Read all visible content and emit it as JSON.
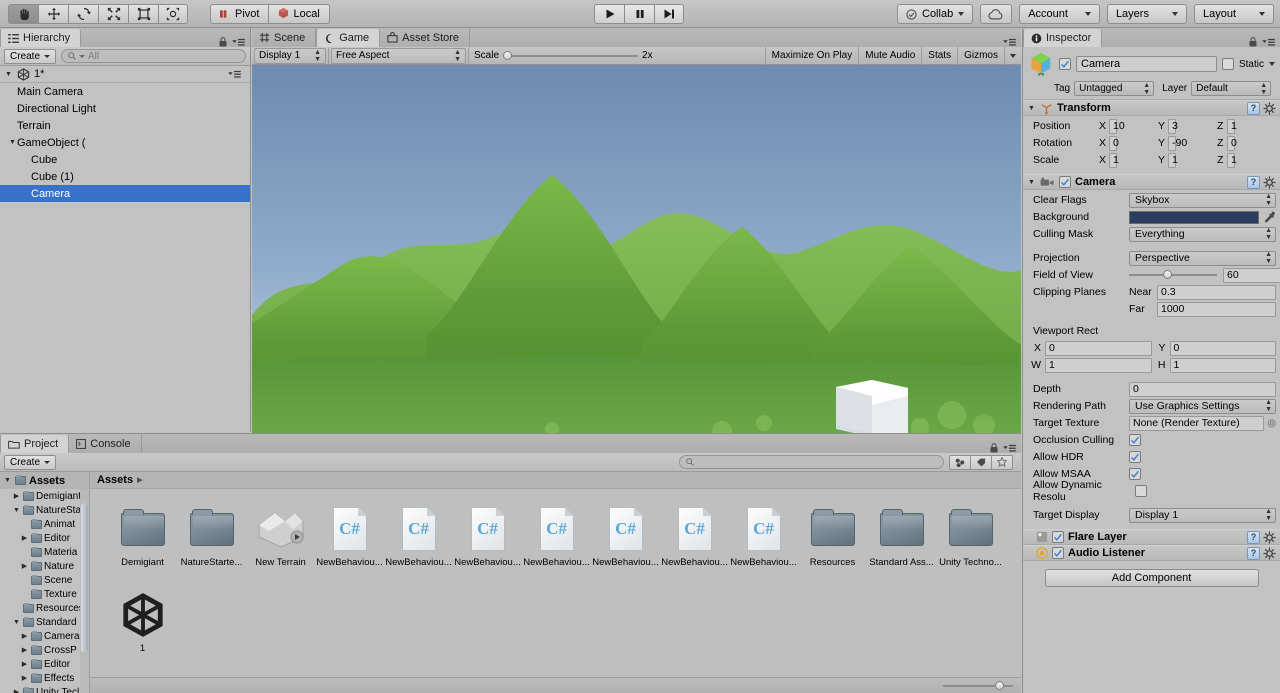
{
  "toolbar": {
    "tools": [
      {
        "name": "hand-tool",
        "active": true
      },
      {
        "name": "move-tool",
        "active": false
      },
      {
        "name": "rotate-tool",
        "active": false
      },
      {
        "name": "scale-tool",
        "active": false
      },
      {
        "name": "rect-tool",
        "active": false
      },
      {
        "name": "transform-tool",
        "active": false
      }
    ],
    "pivot_label": "Pivot",
    "local_label": "Local",
    "play_label": "play-icon",
    "pause_label": "pause-icon",
    "step_label": "step-icon",
    "collab_label": "Collab",
    "cloud_label": "cloud-icon",
    "account_label": "Account",
    "layers_label": "Layers",
    "layout_label": "Layout"
  },
  "hierarchy": {
    "tab_label": "Hierarchy",
    "create_label": "Create",
    "search_placeholder": "All",
    "scene_label": "1*",
    "items": [
      {
        "label": "Main Camera",
        "depth": 1,
        "expandable": false,
        "selected": false
      },
      {
        "label": "Directional Light",
        "depth": 1,
        "expandable": false,
        "selected": false
      },
      {
        "label": "Terrain",
        "depth": 1,
        "expandable": false,
        "selected": false
      },
      {
        "label": "GameObject (",
        "depth": 1,
        "expandable": true,
        "selected": false
      },
      {
        "label": "Cube",
        "depth": 2,
        "expandable": false,
        "selected": false
      },
      {
        "label": "Cube (1)",
        "depth": 2,
        "expandable": false,
        "selected": false
      },
      {
        "label": "Camera",
        "depth": 2,
        "expandable": false,
        "selected": true
      }
    ]
  },
  "gameview": {
    "tabs": [
      {
        "label": "Scene",
        "icon": "grid-icon",
        "selected": false
      },
      {
        "label": "Game",
        "icon": "gamepad-icon",
        "selected": true
      },
      {
        "label": "Asset Store",
        "icon": "store-icon",
        "selected": false
      }
    ],
    "display_label": "Display 1",
    "aspect_label": "Free Aspect",
    "scale_label": "Scale",
    "scale_value": "2x",
    "maximize_label": "Maximize On Play",
    "mute_label": "Mute Audio",
    "stats_label": "Stats",
    "gizmos_label": "Gizmos",
    "sky_top_color": "#6f8cb0",
    "sky_bottom_color": "#c3d5e4",
    "terrain_color": "#5f9a3c",
    "cube_color": "#e9ecef"
  },
  "project": {
    "tabs": [
      {
        "label": "Project",
        "icon": "folder-icon",
        "selected": true
      },
      {
        "label": "Console",
        "icon": "console-icon",
        "selected": false
      }
    ],
    "create_label": "Create",
    "search_placeholder": "",
    "tree_root": "Assets",
    "tree": [
      {
        "label": "Demigiant",
        "depth": 1,
        "expandable": true,
        "expanded": false
      },
      {
        "label": "NatureSta",
        "depth": 1,
        "expandable": true,
        "expanded": true
      },
      {
        "label": "Animat",
        "depth": 2,
        "expandable": false,
        "expanded": false
      },
      {
        "label": "Editor",
        "depth": 2,
        "expandable": true,
        "expanded": false
      },
      {
        "label": "Materia",
        "depth": 2,
        "expandable": false,
        "expanded": false
      },
      {
        "label": "Nature",
        "depth": 2,
        "expandable": true,
        "expanded": false
      },
      {
        "label": "Scene",
        "depth": 2,
        "expandable": false,
        "expanded": false
      },
      {
        "label": "Texture",
        "depth": 2,
        "expandable": false,
        "expanded": false
      },
      {
        "label": "Resources",
        "depth": 1,
        "expandable": false,
        "expanded": false
      },
      {
        "label": "Standard ",
        "depth": 1,
        "expandable": true,
        "expanded": true
      },
      {
        "label": "Camera",
        "depth": 2,
        "expandable": true,
        "expanded": false
      },
      {
        "label": "CrossP",
        "depth": 2,
        "expandable": true,
        "expanded": false
      },
      {
        "label": "Editor",
        "depth": 2,
        "expandable": true,
        "expanded": false
      },
      {
        "label": "Effects",
        "depth": 2,
        "expandable": true,
        "expanded": false
      },
      {
        "label": "Unity Tecl",
        "depth": 1,
        "expandable": true,
        "expanded": false
      }
    ],
    "breadcrumb": "Assets",
    "assets": [
      {
        "label": "Demigiant",
        "type": "folder"
      },
      {
        "label": "NatureStarte...",
        "type": "folder"
      },
      {
        "label": "New Terrain",
        "type": "terrain"
      },
      {
        "label": "NewBehaviou...",
        "type": "csharp"
      },
      {
        "label": "NewBehaviou...",
        "type": "csharp"
      },
      {
        "label": "NewBehaviou...",
        "type": "csharp"
      },
      {
        "label": "NewBehaviou...",
        "type": "csharp"
      },
      {
        "label": "NewBehaviou...",
        "type": "csharp"
      },
      {
        "label": "NewBehaviou...",
        "type": "csharp"
      },
      {
        "label": "NewBehaviou...",
        "type": "csharp"
      },
      {
        "label": "Resources",
        "type": "folder"
      },
      {
        "label": "Standard Ass...",
        "type": "folder"
      },
      {
        "label": "Unity Techno...",
        "type": "folder"
      },
      {
        "label": "1",
        "type": "unity-scene"
      }
    ]
  },
  "inspector": {
    "tab_label": "Inspector",
    "object_name": "Camera",
    "object_enabled": true,
    "static_label": "Static",
    "tag_label": "Tag",
    "tag_value": "Untagged",
    "layer_label": "Layer",
    "layer_value": "Default",
    "transform": {
      "title": "Transform",
      "rows": [
        {
          "label": "Position",
          "x": "10",
          "y": "3",
          "z": "1"
        },
        {
          "label": "Rotation",
          "x": "0",
          "y": "-90",
          "z": "0"
        },
        {
          "label": "Scale",
          "x": "1",
          "y": "1",
          "z": "1"
        }
      ]
    },
    "camera": {
      "title": "Camera",
      "enabled": true,
      "clear_flags_label": "Clear Flags",
      "clear_flags_value": "Skybox",
      "background_label": "Background",
      "background_color": "#2a3f5f",
      "culling_mask_label": "Culling Mask",
      "culling_mask_value": "Everything",
      "projection_label": "Projection",
      "projection_value": "Perspective",
      "fov_label": "Field of View",
      "fov_value": "60",
      "clipping_label": "Clipping Planes",
      "near_label": "Near",
      "near_value": "0.3",
      "far_label": "Far",
      "far_value": "1000",
      "viewport_label": "Viewport Rect",
      "vp_x_label": "X",
      "vp_x": "0",
      "vp_y_label": "Y",
      "vp_y": "0",
      "vp_w_label": "W",
      "vp_w": "1",
      "vp_h_label": "H",
      "vp_h": "1",
      "depth_label": "Depth",
      "depth_value": "0",
      "rendering_path_label": "Rendering Path",
      "rendering_path_value": "Use Graphics Settings",
      "target_texture_label": "Target Texture",
      "target_texture_value": "None (Render Texture)",
      "occlusion_label": "Occlusion Culling",
      "occlusion_on": true,
      "hdr_label": "Allow HDR",
      "hdr_on": true,
      "msaa_label": "Allow MSAA",
      "msaa_on": true,
      "dynres_label": "Allow Dynamic Resolu",
      "dynres_on": false,
      "target_display_label": "Target Display",
      "target_display_value": "Display 1"
    },
    "flare_layer": {
      "title": "Flare Layer",
      "enabled": true
    },
    "audio_listener": {
      "title": "Audio Listener",
      "enabled": true
    },
    "add_component_label": "Add Component"
  }
}
